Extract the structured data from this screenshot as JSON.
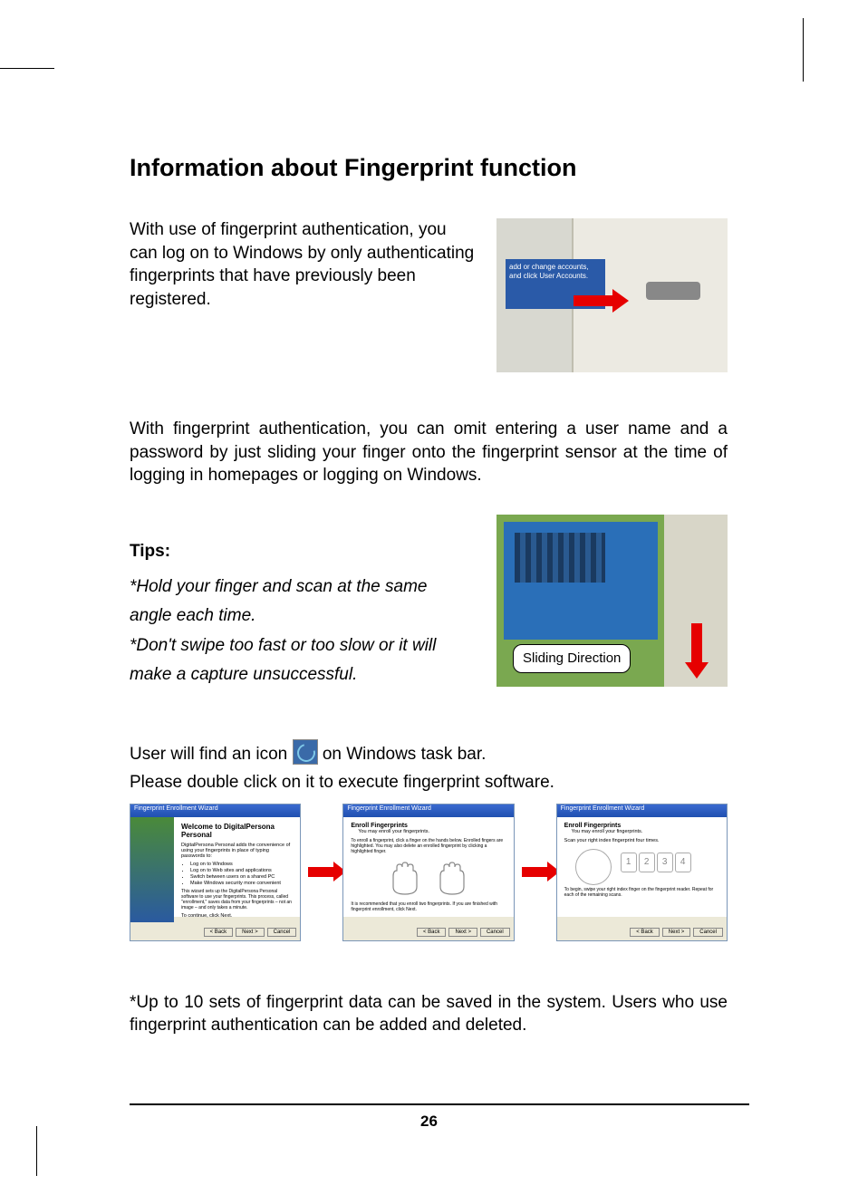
{
  "title": "Information about Fingerprint function",
  "intro": "With use of fingerprint authentication, you can log on to Windows by only authenticating fingerprints that have previously been registered.",
  "img1_text": "add or change accounts, and click User Accounts.",
  "para2": "With fingerprint authentication, you can omit entering a user name and a password by just sliding your finger onto the fingerprint sensor at the time of logging in homepages or logging on Windows.",
  "tips_label": "Tips:",
  "tip1": "*Hold your finger and scan at the same angle each time.",
  "tip2": "*Don't swipe too fast or too slow or it will make a capture unsuccessful.",
  "callout": "Sliding Direction",
  "icon_line_pre": "User will find an icon ",
  "icon_line_post": "on Windows task bar.",
  "exec_line": "Please double click on it to execute fingerprint software.",
  "wiz_title": "Fingerprint Enrollment Wizard",
  "wiz1_headline": "Welcome to DigitalPersona Personal",
  "wiz1_desc": "DigitalPersona Personal adds the convenience of using your fingerprints in place of typing passwords to:",
  "wiz1_items": [
    "Log on to Windows",
    "Log on to Web sites and applications",
    "Switch between users on a shared PC",
    "Make Windows security more convenient"
  ],
  "wiz1_foot": "This wizard sets up the DigitalPersona Personal software to use your fingerprints. This process, called \"enrollment,\" saves data from your fingerprints – not an image – and only takes a minute.",
  "wiz1_cont": "To continue, click Next.",
  "wiz2_h": "Enroll Fingerprints",
  "wiz2_sub": "You may enroll your fingerprints.",
  "wiz2_desc": "To enroll a fingerprint, click a finger on the hands below. Enrolled fingers are highlighted. You may also delete an enrolled fingerprint by clicking a highlighted finger.",
  "wiz2_rec": "It is recommended that you enroll two fingerprints. If you are finished with fingerprint enrollment, click Next.",
  "wiz3_h": "Enroll Fingerprints",
  "wiz3_sub": "You may enroll your fingerprints.",
  "wiz3_scan": "Scan your right index fingerprint four times.",
  "wiz3_begin": "To begin, swipe your right index finger on the fingerprint reader. Repeat for each of the remaining scans.",
  "btn_back": "< Back",
  "btn_next": "Next >",
  "btn_cancel": "Cancel",
  "note": "*Up to 10 sets of fingerprint data can be saved in the system. Users who use fingerprint authentication can be added and deleted.",
  "page_number": "26"
}
